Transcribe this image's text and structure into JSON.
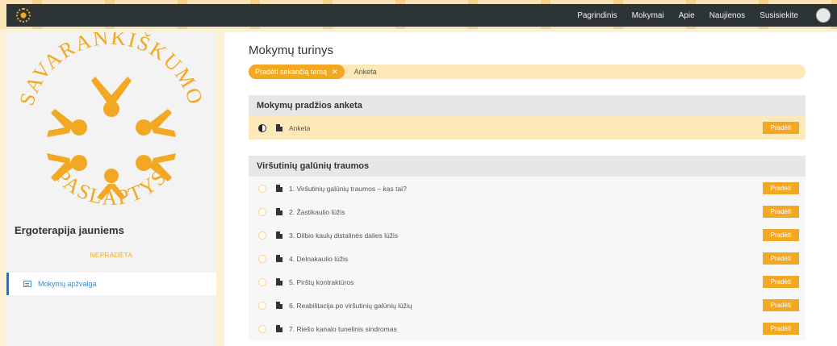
{
  "navbar": {
    "links": [
      "Pagrindinis",
      "Mokymai",
      "Apie",
      "Naujienos",
      "Susisiekite"
    ]
  },
  "sidebar": {
    "logo_text_top": "SAVARANKIŠKUMO",
    "logo_text_bottom": "PASLAPTYS",
    "course_title": "Ergoterapija jauniems",
    "course_status": "NEPRADĖTA",
    "nav_item": "Mokymų apžvalga"
  },
  "main": {
    "title": "Mokymų turinys",
    "filter_chip": "Pradėti sekančią temą",
    "filter_chip_close": "✕",
    "filter_text": "Anketa",
    "start_label": "Pradėti"
  },
  "sections": [
    {
      "title": "Mokymų pradžios anketa",
      "lessons": [
        {
          "label": "Anketa",
          "status": "half"
        }
      ]
    },
    {
      "title": "Viršutinių galūnių traumos",
      "lessons": [
        {
          "label": "1. Viršutinių galūnių traumos – kas tai?",
          "status": "empty"
        },
        {
          "label": "2. Žastikaulio lūžis",
          "status": "empty"
        },
        {
          "label": "3. Dilbio kaulų distalinės dalies lūžis",
          "status": "empty"
        },
        {
          "label": "4. Delnakaulio lūžis",
          "status": "empty"
        },
        {
          "label": "5. Pirštų kontraktūros",
          "status": "empty"
        },
        {
          "label": "6. Reabilitacija po viršutinių galūnių lūžių",
          "status": "empty"
        },
        {
          "label": "7. Riešo kanalo tunelinis sindromas",
          "status": "empty"
        }
      ]
    }
  ],
  "colors": {
    "accent": "#f3a823",
    "navbar": "#2d3435",
    "link_blue": "#3a8ad6"
  }
}
